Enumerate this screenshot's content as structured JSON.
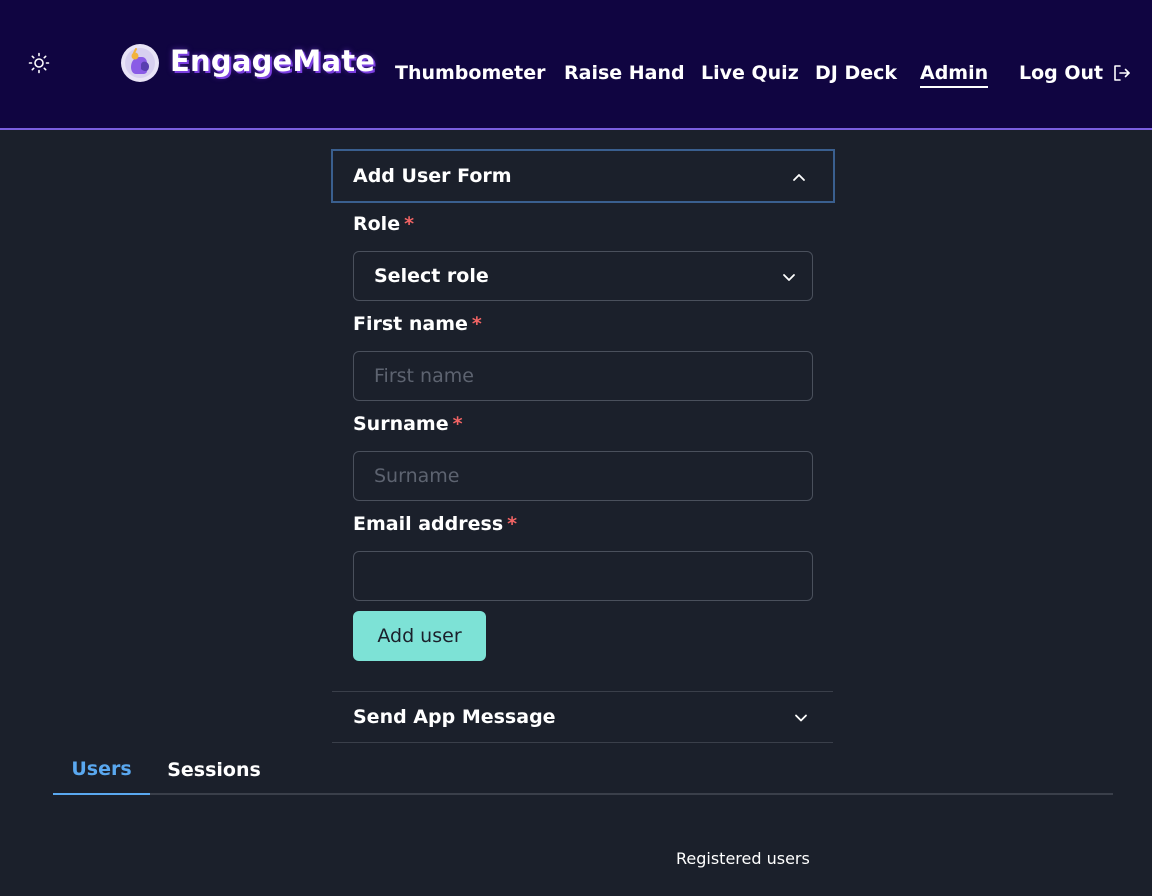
{
  "brand": {
    "name": "EngageMate"
  },
  "icons": {
    "theme": "sun-icon",
    "logo": "engagemate-logo-icon",
    "logout": "logout-icon",
    "panel_open": "chevron-up-icon",
    "panel_closed": "chevron-down-icon"
  },
  "nav": {
    "items": [
      {
        "label": "Thumbometer"
      },
      {
        "label": "Raise Hand"
      },
      {
        "label": "Live Quiz"
      },
      {
        "label": "DJ Deck"
      },
      {
        "label": "Admin"
      }
    ],
    "logout_label": "Log Out"
  },
  "add_user_form": {
    "title": "Add User Form",
    "required_marker": "*",
    "role": {
      "label": "Role",
      "value": "Select role"
    },
    "first_name": {
      "label": "First name",
      "placeholder": "First name",
      "value": ""
    },
    "surname": {
      "label": "Surname",
      "placeholder": "Surname",
      "value": ""
    },
    "email": {
      "label": "Email address",
      "placeholder": "",
      "value": ""
    },
    "submit_label": "Add user"
  },
  "send_message": {
    "title": "Send App Message"
  },
  "tabs": [
    {
      "label": "Users"
    },
    {
      "label": "Sessions"
    }
  ],
  "registered_users_label": "Registered users",
  "colors": {
    "navbar_bg": "#100541",
    "navbar_border": "#7b5fe0",
    "page_bg": "#1b202b",
    "accent_button": "#7de2d6",
    "required": "#f26464",
    "active_tab": "#5aa8f0"
  }
}
